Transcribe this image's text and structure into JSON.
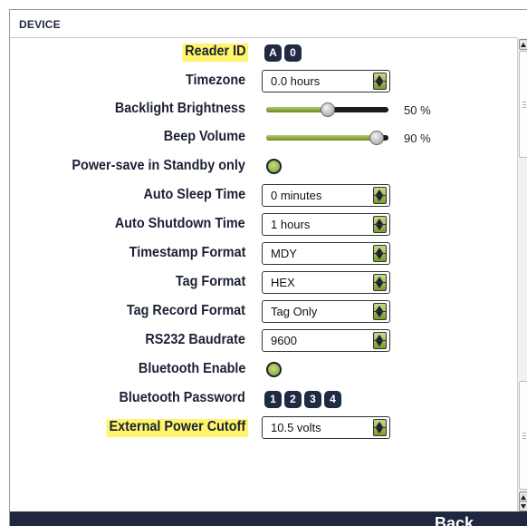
{
  "header": {
    "title": "DEVICE"
  },
  "settings": {
    "reader_id": {
      "label": "Reader ID",
      "keys": [
        "A",
        "0"
      ]
    },
    "timezone": {
      "label": "Timezone",
      "value": "0.0 hours"
    },
    "backlight": {
      "label": "Backlight Brightness",
      "level": 50,
      "percent_text": "50 %"
    },
    "beep": {
      "label": "Beep Volume",
      "level": 90,
      "percent_text": "90 %"
    },
    "power_save": {
      "label": "Power-save in Standby only",
      "enabled": true
    },
    "auto_sleep": {
      "label": "Auto Sleep Time",
      "value": "0 minutes"
    },
    "auto_shutdown": {
      "label": "Auto Shutdown Time",
      "value": "1 hours"
    },
    "timestamp_format": {
      "label": "Timestamp Format",
      "value": "MDY"
    },
    "tag_format": {
      "label": "Tag Format",
      "value": "HEX"
    },
    "tag_record_format": {
      "label": "Tag Record Format",
      "value": "Tag Only"
    },
    "rs232": {
      "label": "RS232 Baudrate",
      "value": "9600"
    },
    "bt_enable": {
      "label": "Bluetooth Enable",
      "enabled": true
    },
    "bt_password": {
      "label": "Bluetooth Password",
      "keys": [
        "1",
        "2",
        "3",
        "4"
      ]
    },
    "ext_power": {
      "label": "External Power Cutoff",
      "value": "10.5 volts"
    }
  },
  "footer": {
    "back_label": "Back"
  },
  "colors": {
    "navy": "#1f2840",
    "highlight": "#fff56a",
    "accent_green": "#7aa028"
  }
}
